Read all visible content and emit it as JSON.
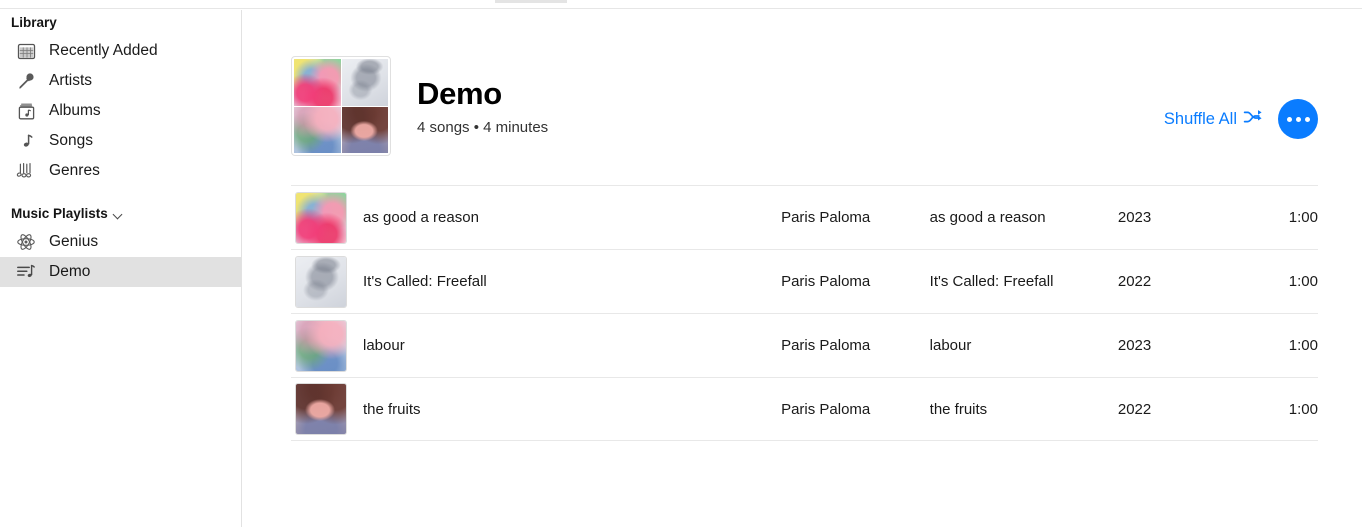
{
  "sidebar": {
    "library_heading": "Library",
    "library_items": [
      {
        "label": "Recently Added",
        "icon": "grid-icon"
      },
      {
        "label": "Artists",
        "icon": "microphone-icon"
      },
      {
        "label": "Albums",
        "icon": "album-icon"
      },
      {
        "label": "Songs",
        "icon": "music-note-icon"
      },
      {
        "label": "Genres",
        "icon": "genres-icon"
      }
    ],
    "playlists_heading": "Music Playlists",
    "playlist_items": [
      {
        "label": "Genius",
        "icon": "atom-icon",
        "selected": false
      },
      {
        "label": "Demo",
        "icon": "playlist-icon",
        "selected": true
      }
    ]
  },
  "header": {
    "title": "Demo",
    "subtitle": "4 songs • 4 minutes",
    "shuffle_label": "Shuffle All",
    "shuffle_icon": "shuffle-icon",
    "more_icon": "ellipsis-icon",
    "accent_color": "#0a7cff"
  },
  "tracks": [
    {
      "title": "as good a reason",
      "artist": "Paris Paloma",
      "album": "as good a reason",
      "year": "2023",
      "duration": "1:00",
      "art": "art-reason"
    },
    {
      "title": "It's Called: Freefall",
      "artist": "Paris Paloma",
      "album": "It's Called: Freefall",
      "year": "2022",
      "duration": "1:00",
      "art": "art-freefall"
    },
    {
      "title": "labour",
      "artist": "Paris Paloma",
      "album": "labour",
      "year": "2023",
      "duration": "1:00",
      "art": "art-labour"
    },
    {
      "title": "the fruits",
      "artist": "Paris Paloma",
      "album": "the fruits",
      "year": "2022",
      "duration": "1:00",
      "art": "art-fruits"
    }
  ]
}
